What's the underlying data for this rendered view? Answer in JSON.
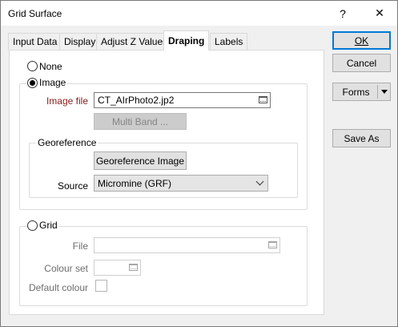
{
  "window": {
    "title": "Grid Surface",
    "help_glyph": "?",
    "close_glyph": "✕"
  },
  "tabs": [
    {
      "label": "Input Data"
    },
    {
      "label": "Display"
    },
    {
      "label": "Adjust Z Values"
    },
    {
      "label": "Draping",
      "active": true
    },
    {
      "label": "Labels"
    }
  ],
  "draping": {
    "none_label": "None",
    "image_label": "Image",
    "image_file_label": "Image file",
    "image_file_value": "CT_AIrPhoto2.jp2",
    "multi_band_button": "Multi Band ...",
    "georeference_group": "Georeference",
    "georeference_button": "Georeference Image",
    "source_label": "Source",
    "source_value": "Micromine (GRF)",
    "grid_label": "Grid",
    "file_label": "File",
    "file_value": "",
    "colour_set_label": "Colour set",
    "colour_set_value": "",
    "default_colour_label": "Default colour",
    "selected_option": "Image"
  },
  "buttons": {
    "ok": "OK",
    "cancel": "Cancel",
    "forms": "Forms",
    "save_as": "Save As"
  },
  "colors": {
    "image_file_label": "#8b1a1a",
    "default_button_border": "#0078d7"
  }
}
